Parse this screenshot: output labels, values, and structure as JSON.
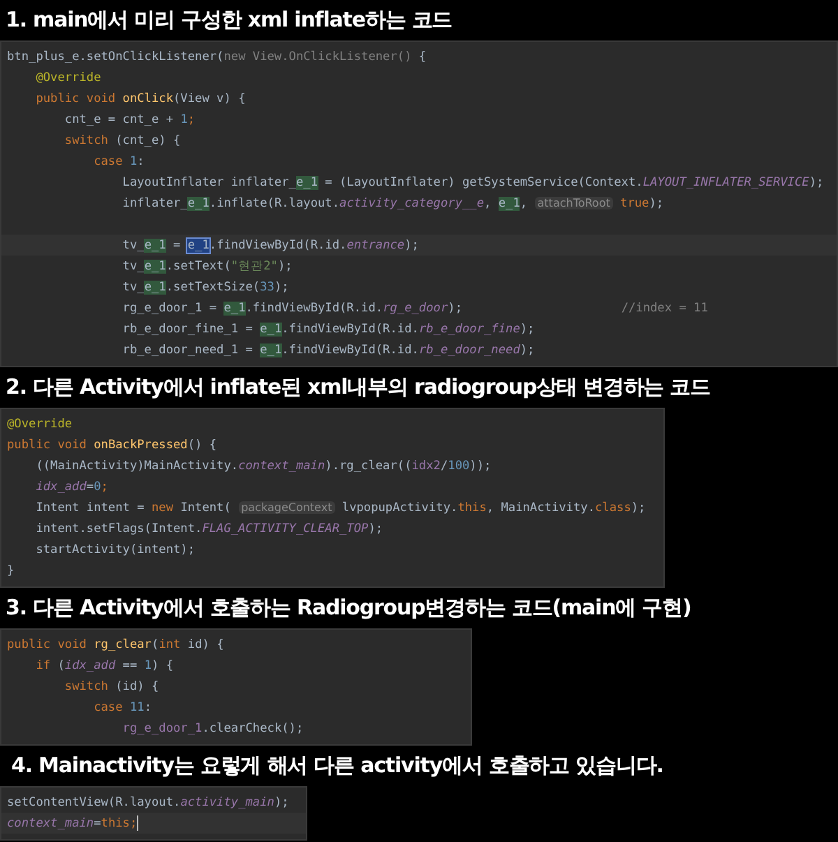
{
  "sections": [
    {
      "heading": "1. main에서 미리 구성한 xml inflate하는 코드",
      "code": [
        {
          "tokens": [
            {
              "text": "btn_plus_e.setOnClickListener(",
              "kind": "plain"
            },
            {
              "text": "new View.OnClickListener()",
              "kind": "muted"
            },
            {
              "text": " {",
              "kind": "plain"
            }
          ],
          "children": [
            {
              "tokens": [
                {
                  "text": "@Override",
                  "kind": "annotation"
                }
              ]
            },
            {
              "tokens": [
                {
                  "text": "public void ",
                  "kind": "keyword"
                },
                {
                  "text": "onClick",
                  "kind": "method"
                },
                {
                  "text": "(View v) {",
                  "kind": "plain"
                }
              ],
              "children": [
                {
                  "tokens": [
                    {
                      "text": "cnt_e = cnt_e + ",
                      "kind": "plain"
                    },
                    {
                      "text": "1",
                      "kind": "number"
                    },
                    {
                      "text": ";",
                      "kind": "keyword"
                    }
                  ]
                },
                {
                  "tokens": [
                    {
                      "text": "switch",
                      "kind": "keyword"
                    },
                    {
                      "text": " (cnt_e) {",
                      "kind": "plain"
                    }
                  ],
                  "children": [
                    {
                      "tokens": [
                        {
                          "text": "case ",
                          "kind": "keyword"
                        },
                        {
                          "text": "1",
                          "kind": "number"
                        },
                        {
                          "text": ":",
                          "kind": "plain"
                        }
                      ],
                      "children": [
                        {
                          "tokens": [
                            {
                              "text": "LayoutInflater inflater_",
                              "kind": "plain"
                            },
                            {
                              "text": "e_1",
                              "kind": "match"
                            },
                            {
                              "text": " = (LayoutInflater) getSystemService(Context.",
                              "kind": "plain"
                            },
                            {
                              "text": "LAYOUT_INFLATER_SERVICE",
                              "kind": "static"
                            },
                            {
                              "text": ");",
                              "kind": "plain"
                            }
                          ]
                        },
                        {
                          "tokens": [
                            {
                              "text": "inflater_",
                              "kind": "plain"
                            },
                            {
                              "text": "e_1",
                              "kind": "match"
                            },
                            {
                              "text": ".inflate(R.layout.",
                              "kind": "plain"
                            },
                            {
                              "text": "activity_category__e",
                              "kind": "static"
                            },
                            {
                              "text": ", ",
                              "kind": "plain"
                            },
                            {
                              "text": "e_1",
                              "kind": "match"
                            },
                            {
                              "text": ", ",
                              "kind": "plain"
                            },
                            {
                              "text": "attachToRoot",
                              "kind": "hint"
                            },
                            {
                              "text": " true",
                              "kind": "keyword"
                            },
                            {
                              "text": ");",
                              "kind": "plain"
                            }
                          ]
                        },
                        {
                          "blank": true
                        },
                        {
                          "current": true,
                          "tokens": [
                            {
                              "text": "tv_",
                              "kind": "plain"
                            },
                            {
                              "text": "e_1",
                              "kind": "match"
                            },
                            {
                              "text": " = ",
                              "kind": "plain"
                            },
                            {
                              "text": "e_1",
                              "kind": "selection"
                            },
                            {
                              "text": ".findViewById(R.id.",
                              "kind": "plain"
                            },
                            {
                              "text": "entrance",
                              "kind": "static"
                            },
                            {
                              "text": ");",
                              "kind": "plain"
                            }
                          ]
                        },
                        {
                          "tokens": [
                            {
                              "text": "tv_",
                              "kind": "plain"
                            },
                            {
                              "text": "e_1",
                              "kind": "match"
                            },
                            {
                              "text": ".setText(",
                              "kind": "plain"
                            },
                            {
                              "text": "\"현관2\"",
                              "kind": "string"
                            },
                            {
                              "text": ");",
                              "kind": "plain"
                            }
                          ]
                        },
                        {
                          "tokens": [
                            {
                              "text": "tv_",
                              "kind": "plain"
                            },
                            {
                              "text": "e_1",
                              "kind": "match"
                            },
                            {
                              "text": ".setTextSize(",
                              "kind": "plain"
                            },
                            {
                              "text": "33",
                              "kind": "number"
                            },
                            {
                              "text": ");",
                              "kind": "plain"
                            }
                          ]
                        },
                        {
                          "tokens": [
                            {
                              "text": "rg_e_door_1 = ",
                              "kind": "plain"
                            },
                            {
                              "text": "e_1",
                              "kind": "match"
                            },
                            {
                              "text": ".findViewById(R.id.",
                              "kind": "plain"
                            },
                            {
                              "text": "rg_e_door",
                              "kind": "static"
                            },
                            {
                              "text": ");",
                              "kind": "plain"
                            },
                            {
                              "text": "//index = 11",
                              "kind": "comment"
                            }
                          ]
                        },
                        {
                          "tokens": [
                            {
                              "text": "rb_e_door_fine_1 = ",
                              "kind": "plain"
                            },
                            {
                              "text": "e_1",
                              "kind": "match"
                            },
                            {
                              "text": ".findViewById(R.id.",
                              "kind": "plain"
                            },
                            {
                              "text": "rb_e_door_fine",
                              "kind": "static"
                            },
                            {
                              "text": ");",
                              "kind": "plain"
                            }
                          ]
                        },
                        {
                          "tokens": [
                            {
                              "text": "rb_e_door_need_1 = ",
                              "kind": "plain"
                            },
                            {
                              "text": "e_1",
                              "kind": "match"
                            },
                            {
                              "text": ".findViewById(R.id.",
                              "kind": "plain"
                            },
                            {
                              "text": "rb_e_door_need",
                              "kind": "static"
                            },
                            {
                              "text": ");",
                              "kind": "plain"
                            }
                          ]
                        }
                      ]
                    }
                  ]
                }
              ]
            }
          ]
        }
      ]
    },
    {
      "heading": "2. 다른 Activity에서 inflate된 xml내부의 radiogroup상태 변경하는 코드",
      "code": [
        {
          "tokens": [
            {
              "text": "@Override",
              "kind": "annotation"
            }
          ]
        },
        {
          "tokens": [
            {
              "text": "public void ",
              "kind": "keyword"
            },
            {
              "text": "onBackPressed",
              "kind": "method"
            },
            {
              "text": "() {",
              "kind": "plain"
            }
          ],
          "children": [
            {
              "tokens": [
                {
                  "text": "((MainActivity)MainActivity.",
                  "kind": "plain"
                },
                {
                  "text": "context_main",
                  "kind": "static"
                },
                {
                  "text": ").rg_clear((",
                  "kind": "plain"
                },
                {
                  "text": "idx2",
                  "kind": "field"
                },
                {
                  "text": "/",
                  "kind": "plain"
                },
                {
                  "text": "100",
                  "kind": "number"
                },
                {
                  "text": "));",
                  "kind": "plain"
                }
              ]
            },
            {
              "tokens": [
                {
                  "text": "idx_add",
                  "kind": "static"
                },
                {
                  "text": "=",
                  "kind": "plain"
                },
                {
                  "text": "0",
                  "kind": "number"
                },
                {
                  "text": ";",
                  "kind": "keyword"
                }
              ]
            },
            {
              "tokens": [
                {
                  "text": "Intent intent = ",
                  "kind": "plain"
                },
                {
                  "text": "new ",
                  "kind": "keyword"
                },
                {
                  "text": "Intent( ",
                  "kind": "plain"
                },
                {
                  "text": "packageContext",
                  "kind": "hint"
                },
                {
                  "text": " lvpopupActivity.",
                  "kind": "plain"
                },
                {
                  "text": "this",
                  "kind": "keyword"
                },
                {
                  "text": ", MainActivity.",
                  "kind": "plain"
                },
                {
                  "text": "class",
                  "kind": "keyword"
                },
                {
                  "text": ");",
                  "kind": "plain"
                }
              ]
            },
            {
              "tokens": [
                {
                  "text": "intent.setFlags(Intent.",
                  "kind": "plain"
                },
                {
                  "text": "FLAG_ACTIVITY_CLEAR_TOP",
                  "kind": "static"
                },
                {
                  "text": ");",
                  "kind": "plain"
                }
              ]
            },
            {
              "tokens": [
                {
                  "text": "startActivity(intent);",
                  "kind": "plain"
                }
              ]
            }
          ]
        },
        {
          "tokens": [
            {
              "text": "}",
              "kind": "plain"
            }
          ]
        }
      ]
    },
    {
      "heading": "3. 다른 Activity에서 호출하는 Radiogroup변경하는 코드(main에 구현)",
      "code": [
        {
          "tokens": [
            {
              "text": "public void ",
              "kind": "keyword"
            },
            {
              "text": "rg_clear",
              "kind": "method"
            },
            {
              "text": "(",
              "kind": "plain"
            },
            {
              "text": "int ",
              "kind": "keyword"
            },
            {
              "text": "id) {",
              "kind": "plain"
            }
          ],
          "children": [
            {
              "tokens": [
                {
                  "text": "if ",
                  "kind": "keyword"
                },
                {
                  "text": "(",
                  "kind": "plain"
                },
                {
                  "text": "idx_add",
                  "kind": "static"
                },
                {
                  "text": " == ",
                  "kind": "plain"
                },
                {
                  "text": "1",
                  "kind": "number"
                },
                {
                  "text": ") {",
                  "kind": "plain"
                }
              ],
              "children": [
                {
                  "tokens": [
                    {
                      "text": "switch ",
                      "kind": "keyword"
                    },
                    {
                      "text": "(id) {",
                      "kind": "plain"
                    }
                  ],
                  "children": [
                    {
                      "tokens": [
                        {
                          "text": "case ",
                          "kind": "keyword"
                        },
                        {
                          "text": "11",
                          "kind": "number"
                        },
                        {
                          "text": ":",
                          "kind": "plain"
                        }
                      ],
                      "children": [
                        {
                          "tokens": [
                            {
                              "text": "rg_e_door_1",
                              "kind": "field"
                            },
                            {
                              "text": ".clearCheck();",
                              "kind": "plain"
                            }
                          ]
                        }
                      ]
                    }
                  ]
                }
              ]
            }
          ]
        }
      ]
    },
    {
      "heading": "4. Mainactivity는 요렇게 해서 다른 activity에서 호출하고 있습니다.",
      "code": [
        {
          "tokens": [
            {
              "text": "setContentView(R.layout.",
              "kind": "plain"
            },
            {
              "text": "activity_main",
              "kind": "static"
            },
            {
              "text": ");",
              "kind": "plain"
            }
          ]
        },
        {
          "current": true,
          "tokens": [
            {
              "text": "context_main",
              "kind": "static"
            },
            {
              "text": "=",
              "kind": "plain"
            },
            {
              "text": "this",
              "kind": "keyword"
            },
            {
              "text": ";",
              "kind": "keyword"
            }
          ]
        }
      ]
    }
  ]
}
